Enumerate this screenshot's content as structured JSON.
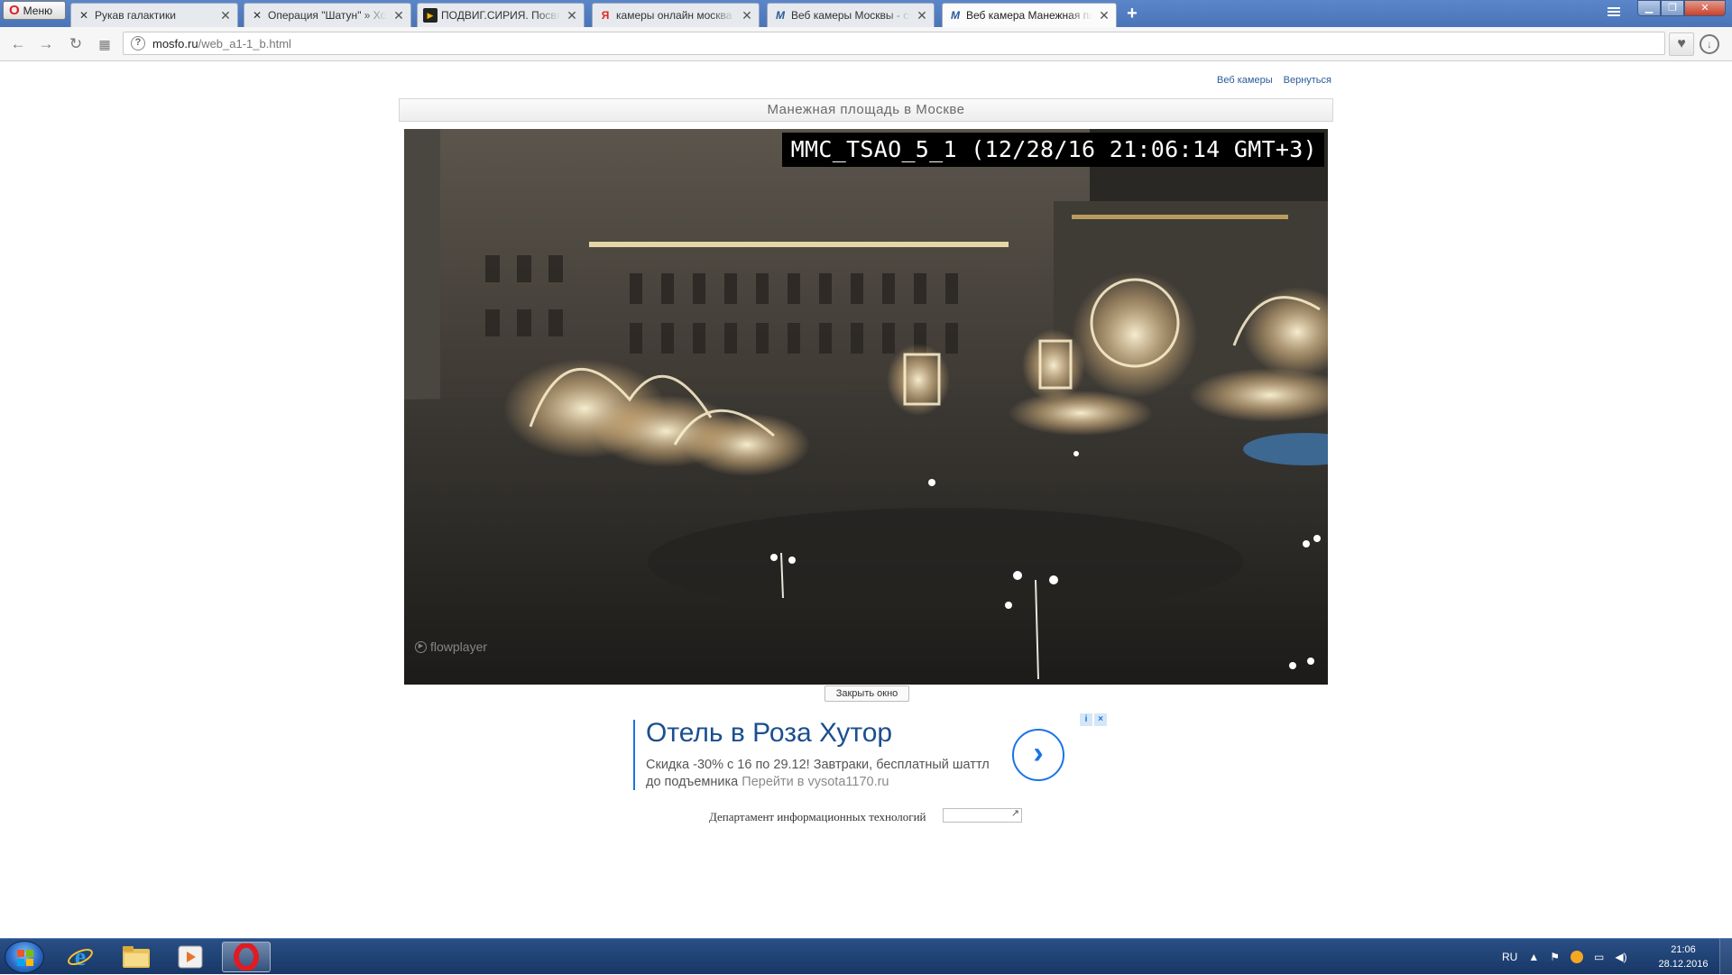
{
  "browser": {
    "menu_label": "Меню",
    "tabs": [
      {
        "label": "Рукав галактики",
        "icon": "x-wing-icon"
      },
      {
        "label": "Операция \"Шатун\" » Хсговт",
        "icon": "x-wing-icon"
      },
      {
        "label": "ПОДВИГ.СИРИЯ. Посвящ",
        "icon": "play-icon"
      },
      {
        "label": "камеры онлайн москва в",
        "icon": "yandex-icon"
      },
      {
        "label": "Веб камеры Москвы - см",
        "icon": "mosfo-icon"
      },
      {
        "label": "Веб камера Манежная пл",
        "icon": "mosfo-icon"
      }
    ],
    "new_tab_label": "+",
    "url_host": "mosfo.ru",
    "url_path": "/web_a1-1_b.html"
  },
  "page": {
    "links": [
      "Веб камеры",
      "Вернуться"
    ],
    "title": "Манежная площадь в Москве",
    "camera_overlay": "MMC_TSAO_5_1 (12/28/16 21:06:14 GMT+3)",
    "player_brand": "flowplayer",
    "close_button": "Закрыть окно",
    "footer_text": "Департамент информационных технологий",
    "counter_symbol": "↗"
  },
  "ad": {
    "title": "Отель в Роза Хутор",
    "desc": "Скидка -30% с 16 по 29.12! Завтраки, бесплатный шаттл до подъемника",
    "link": "Перейти в vysota1170.ru",
    "info_icons": [
      "i",
      "×"
    ],
    "arrow": "›"
  },
  "taskbar": {
    "lang": "RU",
    "time": "21:06",
    "date": "28.12.2016"
  },
  "colors": {
    "tabbar": "#4a74b8",
    "link": "#2a5a98",
    "ad_accent": "#1a73e8",
    "taskbar": "#173766"
  }
}
